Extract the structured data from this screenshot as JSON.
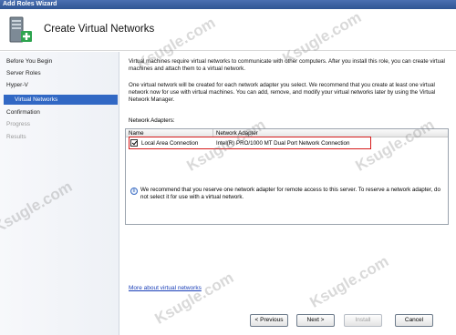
{
  "window": {
    "title": "Add Roles Wizard"
  },
  "header": {
    "title": "Create Virtual Networks",
    "icon": "server-roles-wizard-icon"
  },
  "sidebar": {
    "items": [
      {
        "label": "Before You Begin",
        "state": "normal"
      },
      {
        "label": "Server Roles",
        "state": "normal"
      },
      {
        "label": "Hyper-V",
        "state": "normal"
      },
      {
        "label": "Virtual Networks",
        "state": "active"
      },
      {
        "label": "Confirmation",
        "state": "normal"
      },
      {
        "label": "Progress",
        "state": "disabled"
      },
      {
        "label": "Results",
        "state": "disabled"
      }
    ]
  },
  "main": {
    "intro": "Virtual machines require virtual networks to communicate with other computers. After you install this role, you can create virtual machines and attach them to a virtual network.",
    "description": "One virtual network will be created for each network adapter you select. We recommend that you create at least one virtual network now for use with virtual machines. You can add, remove, and modify your virtual networks later by using the Virtual Network Manager.",
    "adapters_label": "Network Adapters:",
    "table": {
      "columns": [
        "Name",
        "Network Adapter"
      ],
      "rows": [
        {
          "checked": true,
          "name": "Local Area Connection",
          "adapter": "Intel(R) PRO/1000 MT Dual Port Network Connection"
        }
      ]
    },
    "info_text": "We recommend that you reserve one network adapter for remote access to this server. To reserve a network adapter, do not select it for use with a virtual network.",
    "link_text": "More about virtual networks"
  },
  "buttons": {
    "previous": "< Previous",
    "next": "Next >",
    "install": "Install",
    "cancel": "Cancel"
  },
  "watermark": "Ksugle.com",
  "colors": {
    "accent": "#3168c4",
    "highlight_border": "#d61a1a",
    "title_bar": "#2f5593"
  }
}
